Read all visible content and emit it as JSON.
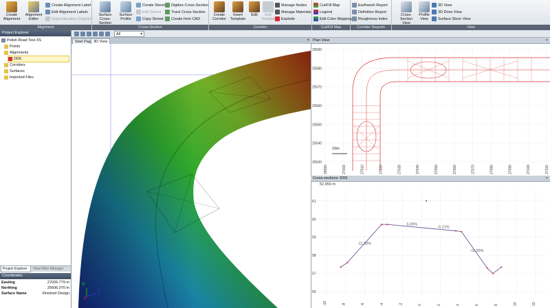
{
  "ribbon": {
    "groups": [
      {
        "label": "Alignment"
      },
      {
        "label": "Cross-Section"
      },
      {
        "label": "Corridor"
      },
      {
        "label": "Cut/Fill Map"
      },
      {
        "label": "Corridor Reports"
      },
      {
        "label": "View"
      }
    ],
    "alignment": {
      "create_alignment": "Create Alignment",
      "alignment_editor": "Alignment Editor",
      "create_alignment_label": "Create Alignment Label",
      "edit_alignment_labels": "Edit Alignment Labels",
      "superelevation_diagram": "Superelevation Diagram"
    },
    "cross_section": {
      "surface_cross_section": "Surface Cross-Section",
      "surface_profile": "Surface Profile",
      "create_stored": "Create Stored",
      "edit_stored": "Edit Stored",
      "copy_stored": "Copy Stored",
      "digitize_cross_section": "Digitize Cross-Section",
      "track_cross_section": "Track Cross-Section",
      "create_from_cad": "Create from CAD"
    },
    "corridor": {
      "create_corridor": "Create Corridor",
      "insert_template": "Insert Template",
      "edit": "Edit",
      "edit_template": "Edit Template",
      "manage_nodes": "Manage Nodes",
      "manage_materials": "Manage Materials",
      "explode": "Explode"
    },
    "cutfill": {
      "cut_fill_map": "Cut/Fill Map",
      "legend": "Legend",
      "edit_color_mapping": "Edit Color Mapping"
    },
    "reports": {
      "earthwork_report": "Earthwork Report",
      "definition_report": "Definition Report",
      "roughness_index": "Roughness Index"
    },
    "view": {
      "cross_section_view": "Cross-Section View",
      "profile_view": "Profile View",
      "view_3d": "3D View",
      "drive_view_3d": "3D Drive View",
      "surface_slicer_view": "Surface Slicer View"
    }
  },
  "toolbar": {
    "filter_value": "All"
  },
  "project_explorer": {
    "title": "Project Explorer",
    "items": [
      {
        "label": "Polish Road Test XS"
      },
      {
        "label": "Points"
      },
      {
        "label": "Alignments"
      },
      {
        "label": "DD6"
      },
      {
        "label": "Corridors"
      },
      {
        "label": "Surfaces"
      },
      {
        "label": "Imported Files"
      }
    ],
    "tabs": [
      {
        "label": "Project Explorer"
      },
      {
        "label": "View Filter Manager"
      }
    ]
  },
  "coordinates": {
    "title": "Coordinates",
    "rows": [
      {
        "key": "Easting",
        "value": "27026.779 m"
      },
      {
        "key": "Northing",
        "value": "25606.070 m"
      },
      {
        "key": "Surface Name",
        "value": "Finished Design"
      }
    ]
  },
  "views": {
    "tabs": [
      {
        "label": "Start Page"
      },
      {
        "label": "3D View"
      }
    ],
    "plan_title": "Plan View",
    "xs_title": "Cross-sections: DD6",
    "axis_label_n": "N",
    "axis_label_e": "E"
  },
  "plan_view": {
    "y_ticks": [
      "25590",
      "25580",
      "25570",
      "25560",
      "25550",
      "25540",
      "25530"
    ],
    "x_ticks": [
      "26990",
      "27000",
      "27010",
      "27020",
      "27030",
      "27040",
      "27050",
      "27060",
      "27070",
      "27080",
      "27090",
      "27100",
      "27110"
    ],
    "scale_label": "10m"
  },
  "chart_data": {
    "type": "line",
    "title": "",
    "station_label": "52.950 m",
    "xlabel": "",
    "ylabel": "",
    "x_ticks": [
      -10,
      -8,
      -6,
      -4,
      -2,
      0,
      2,
      4,
      6,
      8,
      10,
      12
    ],
    "y_ticks": [
      56,
      57,
      58,
      59,
      60,
      61
    ],
    "xlim": [
      -11,
      13
    ],
    "ylim": [
      55.7,
      61.6
    ],
    "series": [
      {
        "x": [
          -8.5,
          -7.8,
          -4.2,
          -3.6,
          3.6,
          4.2,
          6.9,
          7.5,
          8.4
        ],
        "y": [
          57.35,
          57.6,
          59.7,
          59.7,
          59.35,
          59.3,
          57.3,
          57.0,
          57.35
        ]
      }
    ],
    "annotations": [
      {
        "text": "-11.50%",
        "x": -6.0,
        "y": 58.6
      },
      {
        "text": "5.09%",
        "x": -1.0,
        "y": 59.65
      },
      {
        "text": "-5.21%",
        "x": 2.3,
        "y": 59.5
      },
      {
        "text": "-11.50%",
        "x": 5.8,
        "y": 58.2
      }
    ],
    "marker": {
      "x": 0.5,
      "y": 61.0
    },
    "grid": true
  }
}
